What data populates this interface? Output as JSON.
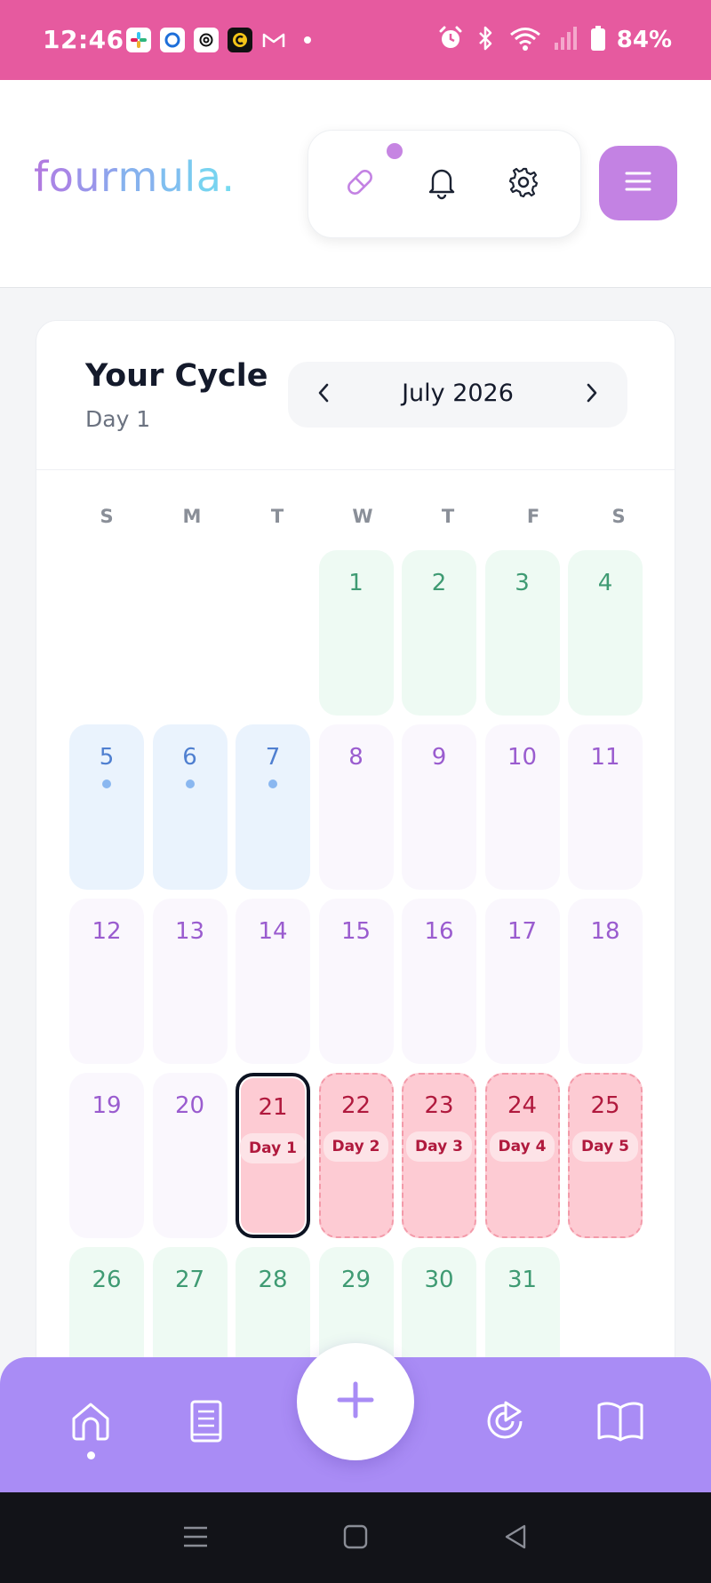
{
  "status_bar": {
    "time": "12:46",
    "battery": "84%",
    "background_color": "#e65a9f",
    "app_icons": [
      "slack-icon",
      "d-app-icon",
      "openai-icon",
      "c-app-icon",
      "gmail-icon"
    ],
    "system_icons": [
      "alarm-icon",
      "bluetooth-icon",
      "wifi-icon",
      "signal-icon",
      "battery-icon"
    ]
  },
  "header": {
    "logo": {
      "letters": [
        "f",
        "o",
        "u",
        "r",
        "m",
        "u",
        "l",
        "a",
        "."
      ],
      "colors": [
        "#b07be0",
        "#a886e6",
        "#9a95ea",
        "#8fa3ec",
        "#86b2ee",
        "#80bff0",
        "#7bcaf0",
        "#78d3f0",
        "#76daf0"
      ]
    },
    "pill_icons": [
      "pill-icon",
      "bell-icon",
      "gear-icon"
    ],
    "menu_icon": "menu-icon",
    "accent": "#c382e3"
  },
  "cycle": {
    "title": "Your Cycle",
    "current_day": "Day 1",
    "month": "July 2026",
    "weekdays": [
      "S",
      "M",
      "T",
      "W",
      "T",
      "F",
      "S"
    ],
    "weeks": [
      [
        null,
        null,
        null,
        {
          "d": "1",
          "type": "green"
        },
        {
          "d": "2",
          "type": "green"
        },
        {
          "d": "3",
          "type": "green"
        },
        {
          "d": "4",
          "type": "green"
        }
      ],
      [
        {
          "d": "5",
          "type": "blue",
          "dot": true
        },
        {
          "d": "6",
          "type": "blue",
          "dot": true
        },
        {
          "d": "7",
          "type": "blue",
          "dot": true
        },
        {
          "d": "8",
          "type": "purple"
        },
        {
          "d": "9",
          "type": "purple"
        },
        {
          "d": "10",
          "type": "purple"
        },
        {
          "d": "11",
          "type": "purple"
        }
      ],
      [
        {
          "d": "12",
          "type": "purple"
        },
        {
          "d": "13",
          "type": "purple"
        },
        {
          "d": "14",
          "type": "purple"
        },
        {
          "d": "15",
          "type": "purple"
        },
        {
          "d": "16",
          "type": "purple"
        },
        {
          "d": "17",
          "type": "purple"
        },
        {
          "d": "18",
          "type": "purple"
        }
      ],
      [
        {
          "d": "19",
          "type": "purple"
        },
        {
          "d": "20",
          "type": "purple"
        },
        {
          "d": "21",
          "type": "today",
          "tag": "Day 1"
        },
        {
          "d": "22",
          "type": "pink",
          "tag": "Day 2"
        },
        {
          "d": "23",
          "type": "pink",
          "tag": "Day 3"
        },
        {
          "d": "24",
          "type": "pink",
          "tag": "Day 4"
        },
        {
          "d": "25",
          "type": "pink",
          "tag": "Day 5"
        }
      ],
      [
        {
          "d": "26",
          "type": "green"
        },
        {
          "d": "27",
          "type": "green"
        },
        {
          "d": "28",
          "type": "green"
        },
        {
          "d": "29",
          "type": "green"
        },
        {
          "d": "30",
          "type": "green"
        },
        {
          "d": "31",
          "type": "green"
        },
        null
      ]
    ]
  },
  "bottom_nav": {
    "items": [
      "home-icon",
      "journal-icon",
      "add-icon",
      "insights-icon",
      "library-icon"
    ],
    "active": "home-icon",
    "background_color": "#a98cf5"
  },
  "system_nav": [
    "recents-icon",
    "home-square-icon",
    "back-icon"
  ]
}
